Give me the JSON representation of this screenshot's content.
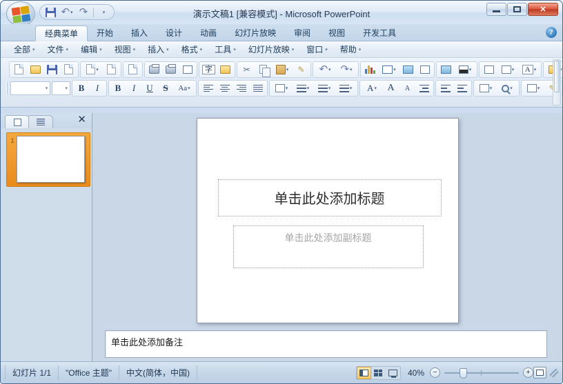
{
  "window": {
    "title": "演示文稿1 [兼容模式] - Microsoft PowerPoint",
    "minimize_label": "",
    "maximize_label": "",
    "close_label": "✕"
  },
  "quick_access": {
    "items": [
      {
        "name": "save",
        "icon": "save-icon"
      },
      {
        "name": "undo",
        "icon": "undo-icon",
        "glyph": "↶"
      },
      {
        "name": "redo",
        "icon": "redo-icon",
        "glyph": "↷"
      },
      {
        "name": "customize",
        "icon": "chevron-down-icon",
        "glyph": "▾"
      }
    ]
  },
  "ribbon_tabs": {
    "active": "经典菜单",
    "items": [
      {
        "label": "经典菜单"
      },
      {
        "label": "开始"
      },
      {
        "label": "插入"
      },
      {
        "label": "设计"
      },
      {
        "label": "动画"
      },
      {
        "label": "幻灯片放映"
      },
      {
        "label": "审阅"
      },
      {
        "label": "视图"
      },
      {
        "label": "开发工具"
      }
    ],
    "help_glyph": "?"
  },
  "classic_menu": {
    "items": [
      {
        "label": "全部"
      },
      {
        "label": "文件"
      },
      {
        "label": "编辑"
      },
      {
        "label": "视图"
      },
      {
        "label": "插入"
      },
      {
        "label": "格式"
      },
      {
        "label": "工具"
      },
      {
        "label": "幻灯片放映"
      },
      {
        "label": "窗口"
      },
      {
        "label": "帮助"
      }
    ],
    "caret": "▾"
  },
  "toolbar_row1": {
    "groups": [
      {
        "buttons": [
          {
            "name": "new-document",
            "icon": "new-document-icon"
          },
          {
            "name": "open",
            "icon": "open-folder-icon"
          },
          {
            "name": "save",
            "icon": "save-icon"
          },
          {
            "name": "save-as-pdf",
            "icon": "save-as-pdf-icon"
          }
        ]
      },
      {
        "buttons": [
          {
            "name": "email",
            "icon": "email-icon",
            "dropdown": true
          },
          {
            "name": "attach",
            "icon": "paperclip-icon"
          }
        ]
      },
      {
        "buttons": [
          {
            "name": "permission",
            "icon": "permission-lock-icon"
          }
        ]
      },
      {
        "buttons": [
          {
            "name": "print",
            "icon": "print-icon"
          },
          {
            "name": "print-preview",
            "icon": "print-preview-icon"
          },
          {
            "name": "slide-frame",
            "icon": "slide-frame-icon"
          }
        ]
      },
      {
        "buttons": [
          {
            "name": "spelling-check",
            "icon": "spelling-check-icon"
          },
          {
            "name": "research",
            "icon": "research-icon"
          }
        ]
      },
      {
        "buttons": [
          {
            "name": "cut",
            "icon": "scissors-icon"
          },
          {
            "name": "copy",
            "icon": "copy-icon"
          },
          {
            "name": "paste",
            "icon": "paste-icon",
            "dropdown": true
          },
          {
            "name": "format-painter",
            "icon": "format-painter-icon"
          }
        ]
      },
      {
        "buttons": [
          {
            "name": "undo",
            "icon": "undo-icon",
            "glyph": "↶",
            "dropdown": true
          },
          {
            "name": "redo",
            "icon": "redo-icon",
            "glyph": "↷",
            "dropdown": true
          }
        ]
      },
      {
        "buttons": [
          {
            "name": "insert-chart",
            "icon": "chart-icon"
          },
          {
            "name": "insert-table",
            "icon": "table-icon",
            "dropdown": true
          },
          {
            "name": "insert-picture",
            "icon": "picture-icon"
          },
          {
            "name": "insert-diagram",
            "icon": "diagram-icon"
          }
        ]
      },
      {
        "buttons": [
          {
            "name": "new-slide",
            "icon": "new-slide-icon"
          },
          {
            "name": "slide-design",
            "icon": "slide-design-icon",
            "dropdown": true
          }
        ]
      },
      {
        "buttons": [
          {
            "name": "insert-textbox",
            "icon": "textbox-icon"
          },
          {
            "name": "slide-layout",
            "icon": "slide-layout-icon",
            "dropdown": true
          },
          {
            "name": "font-style",
            "icon": "font-a-icon",
            "dropdown": true
          }
        ]
      },
      {
        "buttons": [
          {
            "name": "media-gallery",
            "icon": "media-folder-icon",
            "dropdown": true
          },
          {
            "name": "zoom-tool",
            "icon": "search-icon",
            "dropdown": true
          }
        ]
      }
    ]
  },
  "toolbar_row2": {
    "font_name": "",
    "font_size": "",
    "font_name_placeholder": "",
    "font_size_placeholder": "",
    "groups": [
      {
        "buttons": [
          {
            "name": "bold",
            "label": "B"
          },
          {
            "name": "italic",
            "label": "I"
          }
        ]
      },
      {
        "buttons": [
          {
            "name": "bold-2",
            "label": "B"
          },
          {
            "name": "italic-2",
            "label": "I"
          },
          {
            "name": "underline",
            "label": "U"
          },
          {
            "name": "shadow",
            "label": "S"
          },
          {
            "name": "change-case",
            "label": "Aa",
            "dropdown": true
          }
        ]
      },
      {
        "buttons": [
          {
            "name": "align-left",
            "icon": "align-left-icon"
          },
          {
            "name": "align-center",
            "icon": "align-center-icon"
          },
          {
            "name": "align-right",
            "icon": "align-right-icon"
          },
          {
            "name": "align-justify",
            "icon": "align-justify-icon"
          }
        ]
      },
      {
        "buttons": [
          {
            "name": "line-spacing",
            "icon": "line-spacing-icon",
            "dropdown": true
          },
          {
            "name": "text-direction",
            "icon": "text-direction-icon",
            "dropdown": true
          },
          {
            "name": "numbered-list",
            "icon": "numbered-list-icon",
            "dropdown": true
          },
          {
            "name": "bulleted-list",
            "icon": "bulleted-list-icon",
            "dropdown": true
          }
        ]
      },
      {
        "buttons": [
          {
            "name": "font-color",
            "label": "A",
            "dropdown": true
          },
          {
            "name": "increase-font-size",
            "label": "A"
          },
          {
            "name": "decrease-font-size",
            "label": "A"
          },
          {
            "name": "increase-indent",
            "icon": "increase-indent-icon"
          }
        ]
      },
      {
        "buttons": [
          {
            "name": "decrease-indent",
            "icon": "decrease-indent-icon"
          },
          {
            "name": "promote",
            "icon": "promote-icon"
          }
        ]
      },
      {
        "buttons": [
          {
            "name": "insert-shape",
            "icon": "shape-icon",
            "dropdown": true
          },
          {
            "name": "shape-effects",
            "icon": "shape-effects-icon",
            "dropdown": true
          }
        ]
      },
      {
        "buttons": [
          {
            "name": "shape-fill",
            "icon": "shape-fill-icon",
            "dropdown": true
          },
          {
            "name": "shape-outline",
            "icon": "shape-outline-icon"
          }
        ]
      }
    ]
  },
  "left_pane": {
    "tabs": [
      {
        "name": "slides-tab",
        "icon": "slide-thumbnail-icon"
      },
      {
        "name": "outline-tab",
        "icon": "outline-lines-icon"
      }
    ],
    "close_glyph": "✕",
    "slides": [
      {
        "number": "1",
        "selected": true
      }
    ]
  },
  "slide": {
    "title_placeholder": "单击此处添加标题",
    "subtitle_placeholder": "单击此处添加副标题"
  },
  "notes": {
    "placeholder": "单击此处添加备注"
  },
  "status_bar": {
    "slide_counter": "幻灯片 1/1",
    "theme": "\"Office 主题\"",
    "language": "中文(简体，中国)",
    "zoom_level": "40%",
    "zoom_out_glyph": "−",
    "zoom_in_glyph": "+",
    "views": [
      {
        "name": "normal-view",
        "icon": "normal-view-icon",
        "active": true
      },
      {
        "name": "slide-sorter-view",
        "icon": "slide-sorter-icon",
        "active": false
      },
      {
        "name": "slide-show-view",
        "icon": "slide-show-icon",
        "active": false
      }
    ],
    "fit_button": {
      "name": "fit-to-window",
      "icon": "fit-window-icon"
    }
  }
}
